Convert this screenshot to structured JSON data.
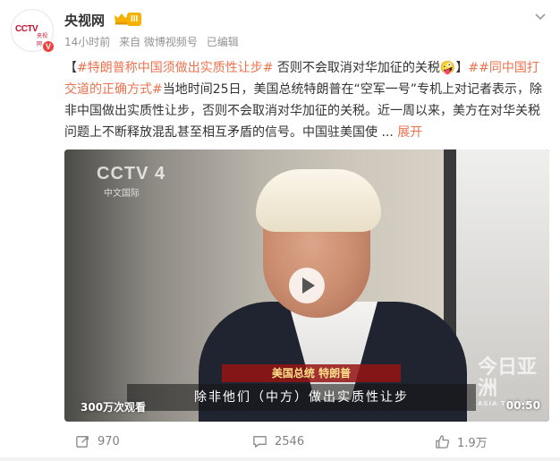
{
  "post": {
    "author": "央视网",
    "level_badge": "III",
    "meta": {
      "time": "14小时前",
      "source": "来自 微博视频号",
      "edited": "已编辑"
    },
    "logo_text": "CCTV",
    "logo_sub": "央视网.com",
    "verified_mark": "V",
    "text": {
      "open_bracket": "【",
      "tag1": "#特朗普称中国须做出实质性让步#",
      "lead": " 否则不会取消对华加征的关税",
      "emoji": "🤪",
      "close_bracket": "】",
      "tag2": "##同中国打交道的正确方式#",
      "body": "当地时间25日，美国总统特朗普在“空军一号”专机上对记者表示，除非中国做出实质性让步，否则不会取消对华加征的关税。近一周以来，美方在对华关税问题上不断释放混乱甚至相互矛盾的信号。中国驻美国使",
      "ellipsis": " ... ",
      "more": "展开"
    },
    "video": {
      "watermark": "CCTV 4",
      "watermark_sub": "中文国际",
      "caption_title": "美国总统 特朗普",
      "caption_main": "除非他们（中方）做出实质性让步",
      "asia_watermark": "今日亚洲",
      "asia_watermark_sub": "ASIA TODAY",
      "views": "300万次观看",
      "duration": "00:50"
    },
    "footer": {
      "repost": "970",
      "comment": "2546",
      "like": "1.9万"
    }
  },
  "colors": {
    "tag": "#eb7350",
    "meta": "#939393",
    "level": "#f7b100",
    "verified": "#f04040"
  }
}
